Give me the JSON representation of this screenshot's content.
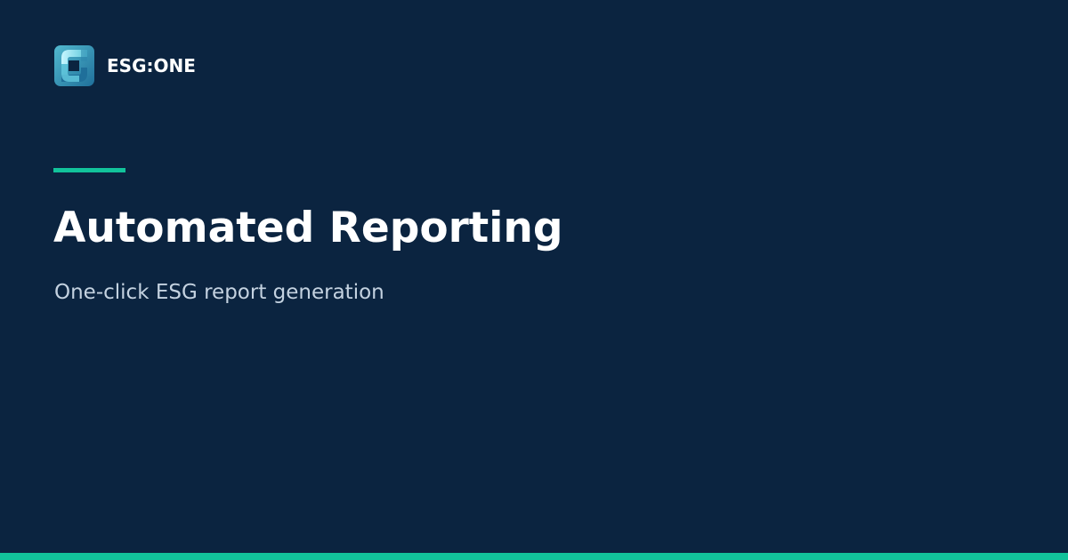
{
  "brand": {
    "name": "ESG:ONE",
    "logo_icon": "esg-one-logo-icon"
  },
  "hero": {
    "title": "Automated Reporting",
    "subtitle": "One-click ESG report generation"
  },
  "colors": {
    "background": "#0b2440",
    "accent": "#12c39b",
    "title_text": "#ffffff",
    "subtitle_text": "#c4d2e0"
  }
}
